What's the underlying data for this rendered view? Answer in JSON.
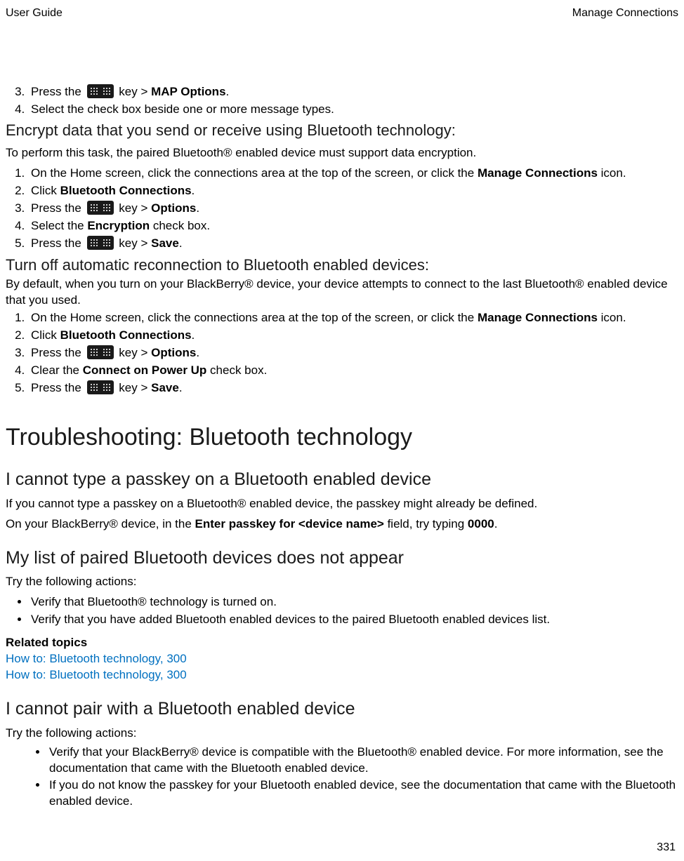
{
  "header": {
    "left": "User Guide",
    "right": "Manage Connections"
  },
  "page_number": "331",
  "pre_steps": {
    "s3": {
      "pre": "Press the ",
      "after_key": " key > ",
      "bold": "MAP Options",
      "tail": "."
    },
    "s4": "Select the check box beside one or more message types."
  },
  "encrypt": {
    "heading": "Encrypt data that you send or receive using Bluetooth technology:",
    "intro": "To perform this task, the paired Bluetooth® enabled device must support data encryption.",
    "s1": {
      "pre": "On the Home screen, click the connections area at the top of the screen, or click the ",
      "bold": "Manage Connections",
      "tail": " icon."
    },
    "s2": {
      "pre": "Click ",
      "bold": "Bluetooth Connections",
      "tail": "."
    },
    "s3": {
      "pre": "Press the ",
      "after_key": " key > ",
      "bold": "Options",
      "tail": "."
    },
    "s4": {
      "pre": "Select the ",
      "bold": "Encryption",
      "tail": " check box."
    },
    "s5": {
      "pre": "Press the ",
      "after_key": " key > ",
      "bold": "Save",
      "tail": "."
    }
  },
  "auto_reconnect": {
    "heading": "Turn off automatic reconnection to Bluetooth enabled devices:",
    "intro": "By default, when you turn on your BlackBerry® device, your device attempts to connect to the last Bluetooth® enabled device that you used.",
    "s1": {
      "pre": "On the Home screen, click the connections area at the top of the screen, or click the ",
      "bold": "Manage Connections",
      "tail": " icon."
    },
    "s2": {
      "pre": "Click ",
      "bold": "Bluetooth Connections",
      "tail": "."
    },
    "s3": {
      "pre": "Press the ",
      "after_key": " key > ",
      "bold": "Options",
      "tail": "."
    },
    "s4": {
      "pre": "Clear the ",
      "bold": "Connect on Power Up",
      "tail": " check box."
    },
    "s5": {
      "pre": "Press the ",
      "after_key": " key > ",
      "bold": "Save",
      "tail": "."
    }
  },
  "troubleshoot_heading": "Troubleshooting: Bluetooth technology",
  "passkey": {
    "heading": "I cannot type a passkey on a Bluetooth enabled device",
    "p1": "If you cannot type a passkey on a Bluetooth® enabled device, the passkey might already be defined.",
    "p2_pre": "On your BlackBerry® device, in the ",
    "p2_bold1": "Enter passkey for <device name>",
    "p2_mid": " field, try typing ",
    "p2_bold2": "0000",
    "p2_tail": "."
  },
  "no_list": {
    "heading": "My list of paired Bluetooth devices does not appear",
    "intro": "Try the following actions:",
    "b1": "Verify that Bluetooth® technology is turned on.",
    "b2": "Verify that you have added Bluetooth enabled devices to the paired Bluetooth enabled devices list."
  },
  "related": {
    "heading": "Related topics",
    "link1": "How to: Bluetooth technology, 300",
    "link2": "How to: Bluetooth technology, 300"
  },
  "cant_pair": {
    "heading": "I cannot pair with a Bluetooth enabled device",
    "intro": "Try the following actions:",
    "b1": "Verify that your BlackBerry® device is compatible with the Bluetooth® enabled device. For more information, see the documentation that came with the Bluetooth enabled device.",
    "b2": "If you do not know the passkey for your Bluetooth enabled device, see the documentation that came with the Bluetooth enabled device."
  }
}
